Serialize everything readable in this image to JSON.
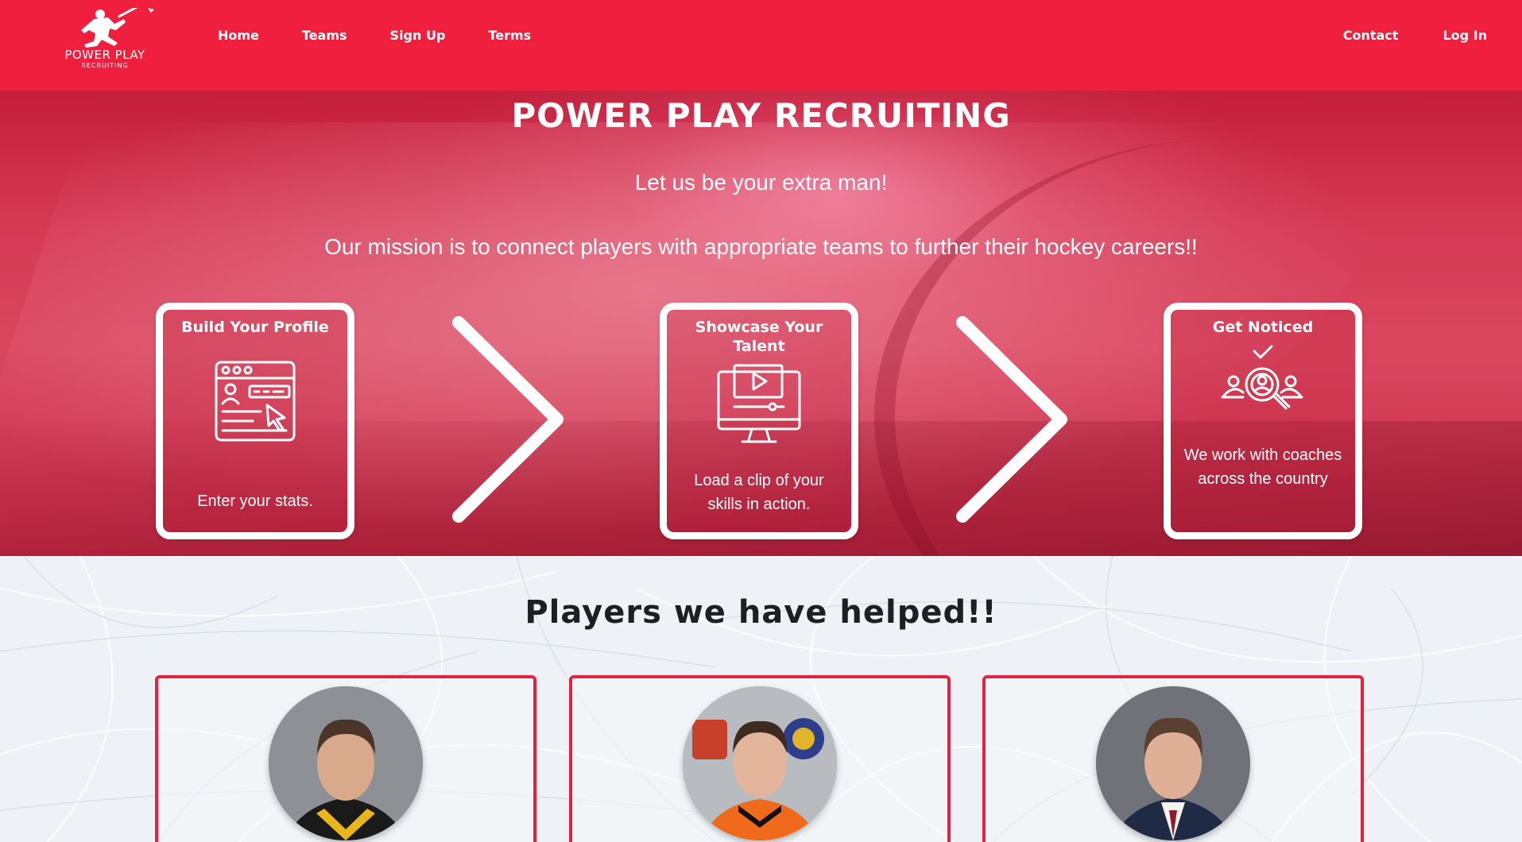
{
  "brand": {
    "name": "POWER PLAY",
    "sub": "RECRUITING",
    "primary_color": "#f01f3e"
  },
  "nav": {
    "left": [
      "Home",
      "Teams",
      "Sign Up",
      "Terms"
    ],
    "right": [
      "Contact",
      "Log In"
    ]
  },
  "hero": {
    "title": "POWER PLAY RECRUITING",
    "tagline": "Let us be your extra man!",
    "mission": "Our mission is to connect players with appropriate teams to further their hockey careers!!"
  },
  "steps": [
    {
      "title": "Build Your Profile",
      "text": "Enter your stats.",
      "icon": "profile-form-icon"
    },
    {
      "title": "Showcase Your Talent",
      "text": "Load a clip of your skills in action.",
      "icon": "video-monitor-icon"
    },
    {
      "title": "Get Noticed",
      "text": "We work with coaches across the country",
      "icon": "search-people-icon"
    }
  ],
  "players_section": {
    "title": "Players we have helped!!",
    "players": [
      {
        "photo": "player-photo-1"
      },
      {
        "photo": "player-photo-2"
      },
      {
        "photo": "player-photo-3"
      }
    ]
  }
}
